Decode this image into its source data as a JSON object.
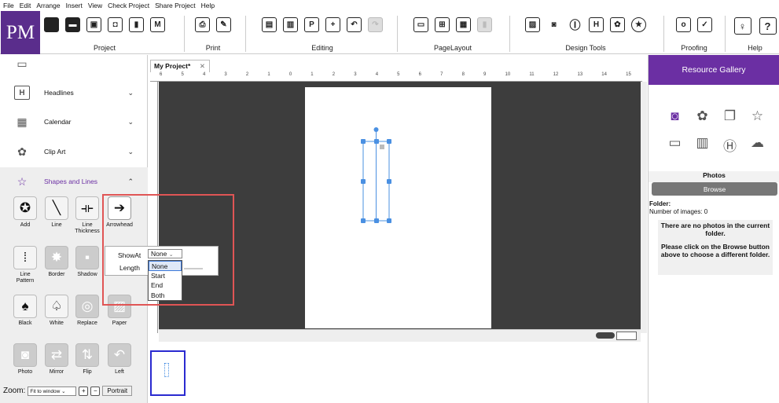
{
  "menu": [
    "File",
    "Edit",
    "Arrange",
    "Insert",
    "View",
    "Check Project",
    "Share Project",
    "Help"
  ],
  "logo": "PM",
  "ribbon": {
    "groups": [
      {
        "label": "Project",
        "icons": [
          "new-icon",
          "open-icon",
          "save-icon",
          "save-as-icon",
          "export-icon",
          "template-icon"
        ]
      },
      {
        "label": "Print",
        "icons": [
          "print-icon",
          "print-preview-icon"
        ]
      },
      {
        "label": "Editing",
        "icons": [
          "cut-icon",
          "copy-icon",
          "paste-icon",
          "add-page-icon",
          "undo-icon",
          "redo-icon"
        ]
      },
      {
        "label": "PageLayout",
        "icons": [
          "page-size-icon",
          "margins-icon",
          "grid-icon",
          "background-icon"
        ]
      },
      {
        "label": "Design Tools",
        "icons": [
          "image-icon",
          "camera-icon",
          "text-icon",
          "headline-icon",
          "clipart-icon",
          "shape-icon"
        ]
      },
      {
        "label": "Proofing",
        "icons": [
          "spellcheck-icon",
          "check-icon"
        ]
      },
      {
        "label": "Help",
        "icons": [
          "tips-icon",
          "help-icon"
        ]
      }
    ]
  },
  "sidebar": {
    "items": [
      {
        "label": "Headlines",
        "icon": "H"
      },
      {
        "label": "Calendar",
        "icon": "▦"
      },
      {
        "label": "Clip Art",
        "icon": "✿"
      },
      {
        "label": "Shapes and Lines",
        "icon": "☆"
      }
    ],
    "tools": [
      "Add",
      "Line",
      "Line Thickness",
      "Arrowhead",
      "Line Pattern",
      "Border",
      "Shadow",
      "Black",
      "White",
      "Replace",
      "Paper",
      "Photo",
      "Mirror",
      "Flip",
      "Left"
    ],
    "zoom_label": "Zoom:",
    "zoom_value": "Fit to window",
    "portrait": "Portrait"
  },
  "popup": {
    "showat_label": "ShowAt",
    "showat_value": "None",
    "length_label": "Length",
    "options": [
      "None",
      "Start",
      "End",
      "Both"
    ]
  },
  "doc": {
    "tab": "My Project*",
    "ruler_numbers": [
      "6",
      "5",
      "4",
      "3",
      "2",
      "1",
      "0",
      "1",
      "2",
      "3",
      "4",
      "5",
      "6",
      "7",
      "8",
      "9",
      "10",
      "11",
      "12",
      "13",
      "14",
      "15"
    ]
  },
  "right": {
    "title": "Resource Gallery",
    "section": "Photos",
    "browse": "Browse",
    "folder": "Folder:",
    "images": "Number of images: 0",
    "msg1": "There are no photos in the current folder.",
    "msg2": "Please click on the Browse button above to choose a different folder."
  }
}
